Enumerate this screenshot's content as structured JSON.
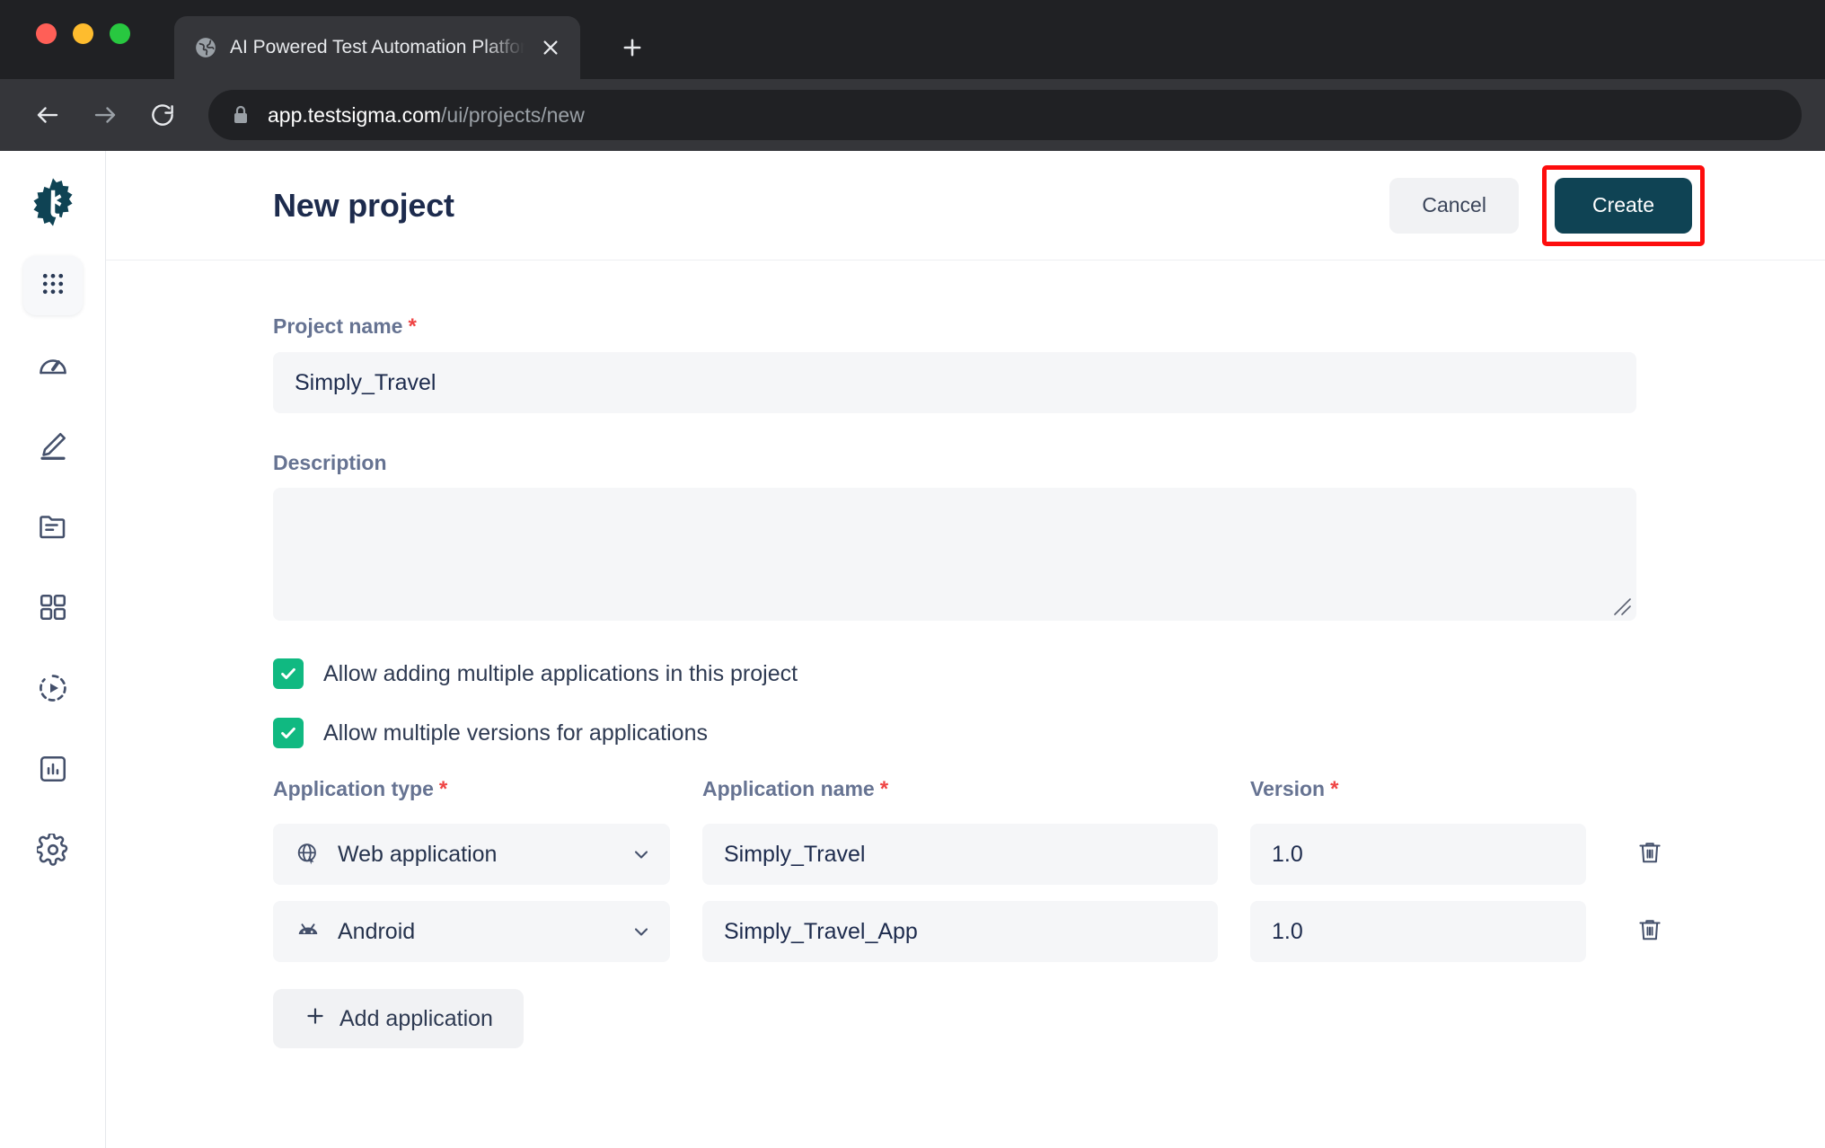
{
  "browser": {
    "tab": {
      "title": "AI Powered Test Automation Platform",
      "favicon": "globe-icon",
      "close": "close-icon"
    },
    "new_tab_label": "+",
    "toolbar": {
      "back": "back-arrow-icon",
      "forward": "forward-arrow-icon",
      "reload": "reload-icon",
      "lock": "lock-icon",
      "url_host": "app.testsigma.com",
      "url_path": "/ui/projects/new"
    }
  },
  "sidebar": {
    "logo": "testsigma-logo-icon",
    "items": [
      {
        "name": "apps-grid",
        "icon": "grid-dots-icon",
        "active": true
      },
      {
        "name": "dashboard",
        "icon": "speedometer-icon",
        "active": false
      },
      {
        "name": "create",
        "icon": "pencil-icon",
        "active": false
      },
      {
        "name": "test-cases",
        "icon": "folder-lines-icon",
        "active": false
      },
      {
        "name": "test-suites",
        "icon": "squares-icon",
        "active": false
      },
      {
        "name": "test-plans",
        "icon": "play-circle-icon",
        "active": false
      },
      {
        "name": "reports",
        "icon": "bar-chart-icon",
        "active": false
      },
      {
        "name": "settings",
        "icon": "gear-icon",
        "active": false
      }
    ]
  },
  "header": {
    "title": "New project",
    "cancel_label": "Cancel",
    "create_label": "Create"
  },
  "form": {
    "project_name": {
      "label": "Project name",
      "required": "*",
      "value": "Simply_Travel",
      "placeholder": ""
    },
    "description": {
      "label": "Description",
      "value": "",
      "placeholder": ""
    },
    "checkboxes": [
      {
        "label": "Allow adding multiple applications in this project",
        "checked": true
      },
      {
        "label": "Allow multiple versions for applications",
        "checked": true
      }
    ],
    "apps_table": {
      "headers": {
        "type": "Application type",
        "type_required": "*",
        "name": "Application name",
        "name_required": "*",
        "version": "Version",
        "version_required": "*"
      },
      "rows": [
        {
          "type": "Web application",
          "type_icon": "globe-cursor-icon",
          "name": "Simply_Travel",
          "version": "1.0",
          "delete_icon": "trash-icon"
        },
        {
          "type": "Android",
          "type_icon": "android-icon",
          "name": "Simply_Travel_App",
          "version": "1.0",
          "delete_icon": "trash-icon"
        }
      ]
    },
    "add_application_label": "Add application",
    "add_application_icon": "plus-icon"
  },
  "colors": {
    "brand_dark": "#0f4354",
    "title": "#1d2b4d",
    "label": "#667392",
    "required": "#ef4444",
    "checkbox": "#10b981",
    "input_bg": "#f5f6f8",
    "highlight_box": "#fd0d0d"
  }
}
